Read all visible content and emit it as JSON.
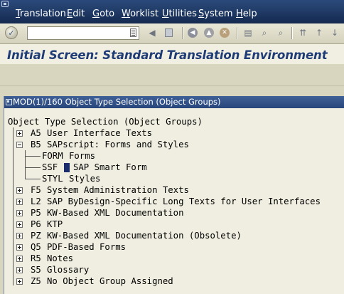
{
  "menu": {
    "items": [
      {
        "label": "Translation",
        "first": "T",
        "rest": "ranslation"
      },
      {
        "label": "Edit",
        "first": "E",
        "rest": "dit"
      },
      {
        "label": "Goto",
        "first": "G",
        "rest": "oto"
      },
      {
        "label": "Worklist",
        "first": "W",
        "rest": "orklist"
      },
      {
        "label": "Utilities",
        "first": "U",
        "rest": "tilities"
      },
      {
        "label": "System",
        "first": "S",
        "rest": "ystem"
      },
      {
        "label": "Help",
        "first": "H",
        "rest": "elp"
      }
    ]
  },
  "toolbar": {
    "command_value": "",
    "icons": [
      "enter-icon",
      "save-icon",
      "back-icon",
      "exit-icon",
      "cancel-icon",
      "print-icon",
      "find-icon",
      "find-next-icon",
      "first-page-icon",
      "previous-page-icon"
    ]
  },
  "title": "Initial Screen: Standard Translation Environment",
  "panel": {
    "header": "MOD(1)/160 Object Type Selection (Object Groups)"
  },
  "tree": {
    "root": "Object Type Selection (Object Groups)",
    "groups": [
      {
        "code": "A5",
        "text": "User Interface Texts",
        "expanded": false
      },
      {
        "code": "B5",
        "text": "SAPscript: Forms and Styles",
        "expanded": true,
        "children": [
          {
            "code": "FORM",
            "text": "Forms",
            "selected": false
          },
          {
            "code": "SSF",
            "text": "SAP Smart Form",
            "selected": true
          },
          {
            "code": "STYL",
            "text": "Styles",
            "selected": false
          }
        ]
      },
      {
        "code": "F5",
        "text": "System Administration Texts",
        "expanded": false
      },
      {
        "code": "L2",
        "text": "SAP ByDesign-Specific Long Texts for User Interfaces",
        "expanded": false
      },
      {
        "code": "P5",
        "text": "KW-Based XML Documentation",
        "expanded": false
      },
      {
        "code": "P6",
        "text": "KTP",
        "expanded": false
      },
      {
        "code": "PZ",
        "text": "KW-Based XML Documentation (Obsolete)",
        "expanded": false
      },
      {
        "code": "Q5",
        "text": "PDF-Based Forms",
        "expanded": false
      },
      {
        "code": "R5",
        "text": "Notes",
        "expanded": false
      },
      {
        "code": "S5",
        "text": "Glossary",
        "expanded": false
      },
      {
        "code": "Z5",
        "text": "No Object Group Assigned",
        "expanded": false
      }
    ]
  },
  "colors": {
    "menubar": "#1c3461",
    "title": "#1f3c77",
    "panel_header": "#2f5088",
    "selection": "#1a2c6b"
  }
}
